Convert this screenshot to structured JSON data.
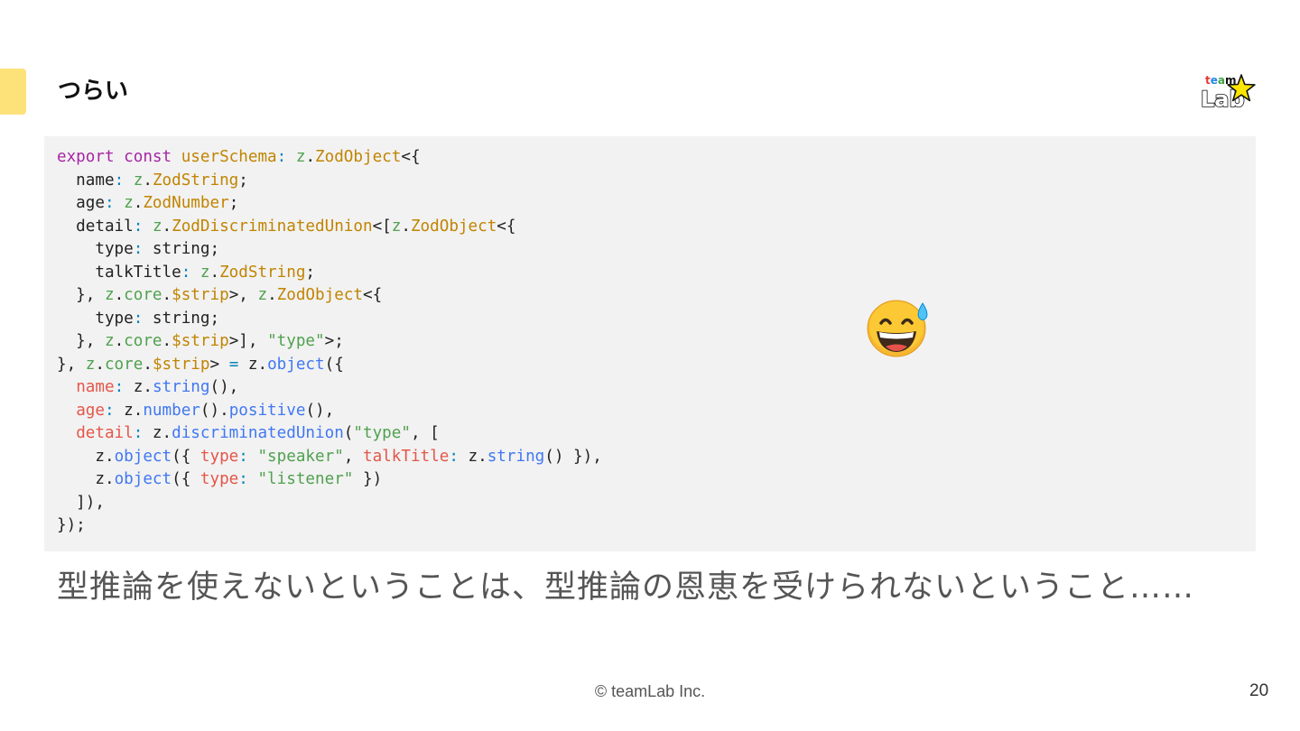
{
  "slide": {
    "title": "つらい",
    "caption": "型推論を使えないということは、型推論の恩恵を受けられないということ……",
    "footer": "© teamLab Inc.",
    "page_number": "20",
    "accent_color": "#fde27a",
    "code_background": "#f2f2f2"
  },
  "logo": {
    "text_top": "team",
    "text_bottom": "Lab",
    "icon": "star-icon"
  },
  "emoji": {
    "icon": "grinning-face-with-sweat-icon",
    "glyph": "😅"
  },
  "code": {
    "language": "typescript",
    "lines": [
      [
        [
          "kw",
          "export"
        ],
        [
          "pl",
          " "
        ],
        [
          "kw",
          "const"
        ],
        [
          "pl",
          " "
        ],
        [
          "ty",
          "userSchema"
        ],
        [
          "op",
          ":"
        ],
        [
          "pl",
          " "
        ],
        [
          "ns",
          "z"
        ],
        [
          "pl",
          "."
        ],
        [
          "ty",
          "ZodObject"
        ],
        [
          "pl",
          "<{"
        ]
      ],
      [
        [
          "pl",
          "  name"
        ],
        [
          "op",
          ":"
        ],
        [
          "pl",
          " "
        ],
        [
          "ns",
          "z"
        ],
        [
          "pl",
          "."
        ],
        [
          "ty",
          "ZodString"
        ],
        [
          "pl",
          ";"
        ]
      ],
      [
        [
          "pl",
          "  age"
        ],
        [
          "op",
          ":"
        ],
        [
          "pl",
          " "
        ],
        [
          "ns",
          "z"
        ],
        [
          "pl",
          "."
        ],
        [
          "ty",
          "ZodNumber"
        ],
        [
          "pl",
          ";"
        ]
      ],
      [
        [
          "pl",
          "  detail"
        ],
        [
          "op",
          ":"
        ],
        [
          "pl",
          " "
        ],
        [
          "ns",
          "z"
        ],
        [
          "pl",
          "."
        ],
        [
          "ty",
          "ZodDiscriminatedUnion"
        ],
        [
          "pl",
          "<["
        ],
        [
          "ns",
          "z"
        ],
        [
          "pl",
          "."
        ],
        [
          "ty",
          "ZodObject"
        ],
        [
          "pl",
          "<{"
        ]
      ],
      [
        [
          "pl",
          "    type"
        ],
        [
          "op",
          ":"
        ],
        [
          "pl",
          " string;"
        ]
      ],
      [
        [
          "pl",
          "    talkTitle"
        ],
        [
          "op",
          ":"
        ],
        [
          "pl",
          " "
        ],
        [
          "ns",
          "z"
        ],
        [
          "pl",
          "."
        ],
        [
          "ty",
          "ZodString"
        ],
        [
          "pl",
          ";"
        ]
      ],
      [
        [
          "pl",
          "  }, "
        ],
        [
          "ns",
          "z"
        ],
        [
          "pl",
          "."
        ],
        [
          "ns",
          "core"
        ],
        [
          "pl",
          "."
        ],
        [
          "ty",
          "$strip"
        ],
        [
          "pl",
          ">, "
        ],
        [
          "ns",
          "z"
        ],
        [
          "pl",
          "."
        ],
        [
          "ty",
          "ZodObject"
        ],
        [
          "pl",
          "<{"
        ]
      ],
      [
        [
          "pl",
          "    type"
        ],
        [
          "op",
          ":"
        ],
        [
          "pl",
          " string;"
        ]
      ],
      [
        [
          "pl",
          "  }, "
        ],
        [
          "ns",
          "z"
        ],
        [
          "pl",
          "."
        ],
        [
          "ns",
          "core"
        ],
        [
          "pl",
          "."
        ],
        [
          "ty",
          "$strip"
        ],
        [
          "pl",
          ">], "
        ],
        [
          "st",
          "\"type\""
        ],
        [
          "pl",
          ">;"
        ]
      ],
      [
        [
          "pl",
          "}, "
        ],
        [
          "ns",
          "z"
        ],
        [
          "pl",
          "."
        ],
        [
          "ns",
          "core"
        ],
        [
          "pl",
          "."
        ],
        [
          "ty",
          "$strip"
        ],
        [
          "pl",
          "> "
        ],
        [
          "op",
          "="
        ],
        [
          "pl",
          " z."
        ],
        [
          "fn",
          "object"
        ],
        [
          "pl",
          "({"
        ]
      ],
      [
        [
          "pl",
          "  "
        ],
        [
          "pr",
          "name"
        ],
        [
          "op",
          ":"
        ],
        [
          "pl",
          " z."
        ],
        [
          "fn",
          "string"
        ],
        [
          "pl",
          "(),"
        ]
      ],
      [
        [
          "pl",
          "  "
        ],
        [
          "pr",
          "age"
        ],
        [
          "op",
          ":"
        ],
        [
          "pl",
          " z."
        ],
        [
          "fn",
          "number"
        ],
        [
          "pl",
          "()."
        ],
        [
          "fn",
          "positive"
        ],
        [
          "pl",
          "(),"
        ]
      ],
      [
        [
          "pl",
          "  "
        ],
        [
          "pr",
          "detail"
        ],
        [
          "op",
          ":"
        ],
        [
          "pl",
          " z."
        ],
        [
          "fn",
          "discriminatedUnion"
        ],
        [
          "pl",
          "("
        ],
        [
          "st",
          "\"type\""
        ],
        [
          "pl",
          ", ["
        ]
      ],
      [
        [
          "pl",
          "    z."
        ],
        [
          "fn",
          "object"
        ],
        [
          "pl",
          "({ "
        ],
        [
          "pr",
          "type"
        ],
        [
          "op",
          ":"
        ],
        [
          "pl",
          " "
        ],
        [
          "st",
          "\"speaker\""
        ],
        [
          "pl",
          ", "
        ],
        [
          "pr",
          "talkTitle"
        ],
        [
          "op",
          ":"
        ],
        [
          "pl",
          " z."
        ],
        [
          "fn",
          "string"
        ],
        [
          "pl",
          "() }),"
        ]
      ],
      [
        [
          "pl",
          "    z."
        ],
        [
          "fn",
          "object"
        ],
        [
          "pl",
          "({ "
        ],
        [
          "pr",
          "type"
        ],
        [
          "op",
          ":"
        ],
        [
          "pl",
          " "
        ],
        [
          "st",
          "\"listener\""
        ],
        [
          "pl",
          " })"
        ]
      ],
      [
        [
          "pl",
          "  ]),"
        ]
      ],
      [
        [
          "pl",
          "});"
        ]
      ]
    ]
  }
}
